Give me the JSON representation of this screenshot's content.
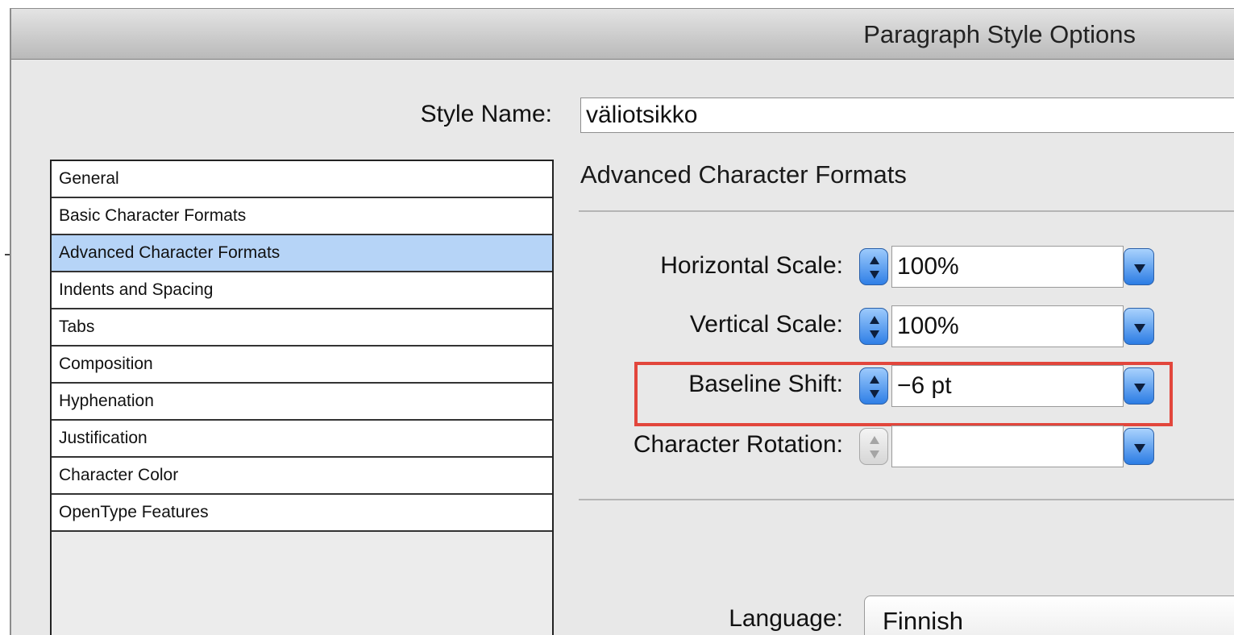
{
  "window": {
    "title": "Paragraph Style Options"
  },
  "style_name": {
    "label": "Style Name:",
    "value": "väliotsikko"
  },
  "categories": [
    {
      "label": "General",
      "selected": false
    },
    {
      "label": "Basic Character Formats",
      "selected": false
    },
    {
      "label": "Advanced Character Formats",
      "selected": true
    },
    {
      "label": "Indents and Spacing",
      "selected": false
    },
    {
      "label": "Tabs",
      "selected": false
    },
    {
      "label": "Composition",
      "selected": false
    },
    {
      "label": "Hyphenation",
      "selected": false
    },
    {
      "label": "Justification",
      "selected": false
    },
    {
      "label": "Character Color",
      "selected": false
    },
    {
      "label": "OpenType Features",
      "selected": false
    }
  ],
  "section": {
    "title": "Advanced Character Formats"
  },
  "fields": {
    "horizontal_scale": {
      "label": "Horizontal Scale:",
      "value": "100%"
    },
    "vertical_scale": {
      "label": "Vertical Scale:",
      "value": "100%"
    },
    "baseline_shift": {
      "label": "Baseline Shift:",
      "value": "−6 pt"
    },
    "character_rotation": {
      "label": "Character Rotation:",
      "value": ""
    }
  },
  "language": {
    "label": "Language:",
    "value": "Finnish"
  },
  "colors": {
    "selection": "#b6d4f7",
    "highlight": "#e2463c",
    "accent": "#2f7fe6"
  },
  "icons": [
    "stepper-icon",
    "dropdown-arrow-icon"
  ]
}
